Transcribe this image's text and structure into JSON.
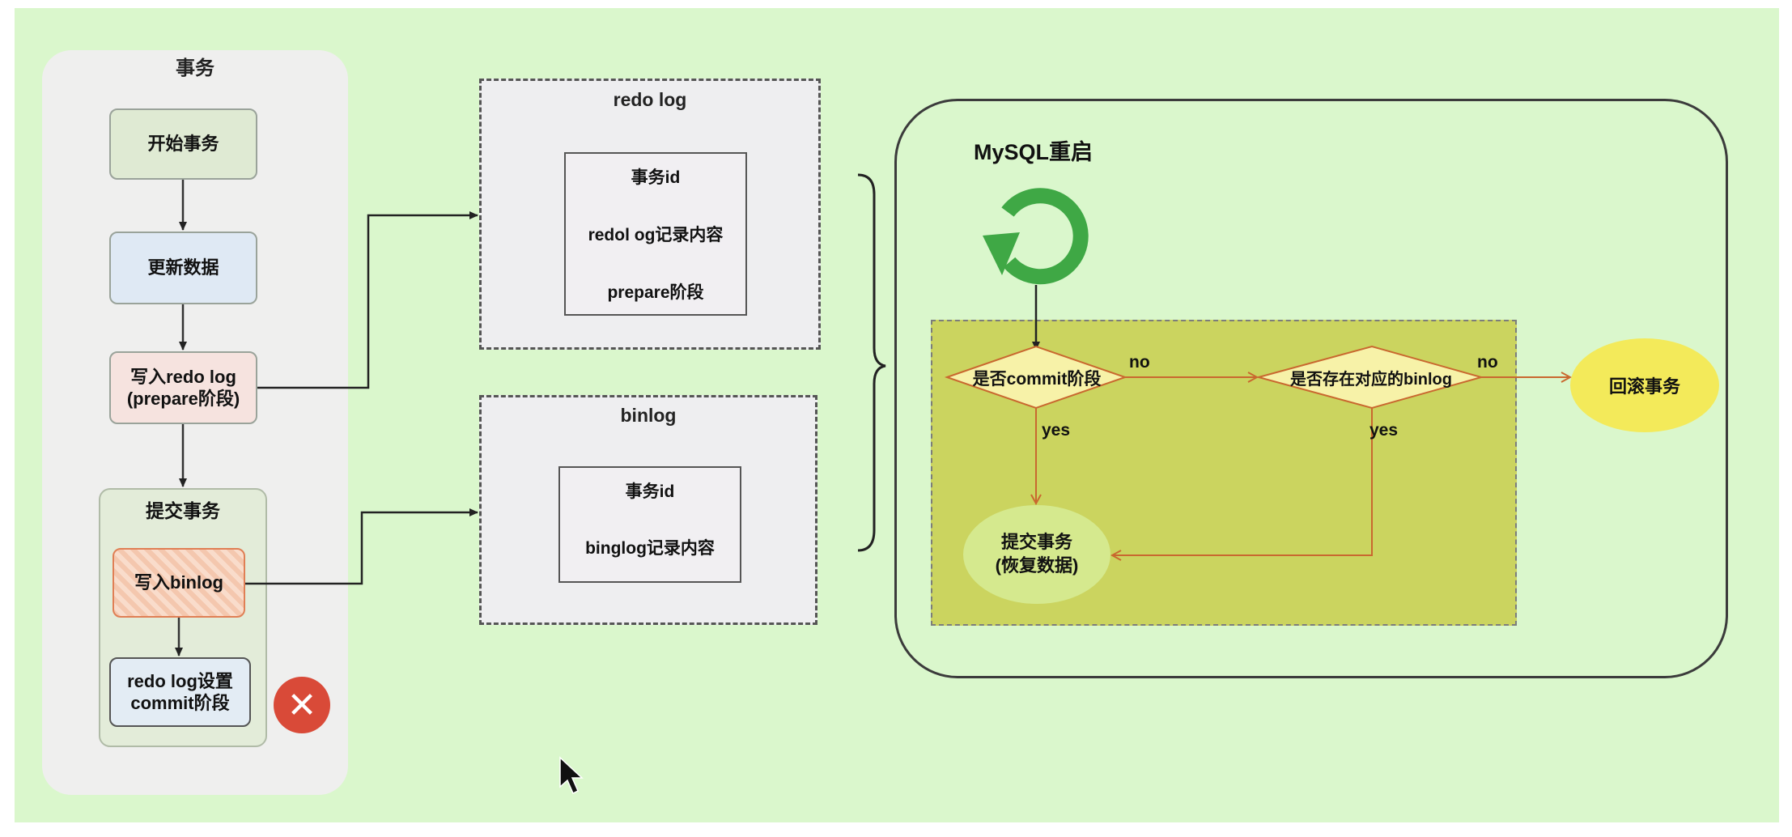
{
  "transaction": {
    "title": "事务",
    "start": "开始事务",
    "update": "更新数据",
    "write_redo_line1": "写入redo log",
    "write_redo_line2": "(prepare阶段)",
    "commit_title": "提交事务",
    "write_binlog": "写入binlog",
    "redo_commit_line1": "redo log设置",
    "redo_commit_line2": "commit阶段",
    "error_icon": "✕"
  },
  "redo_log": {
    "title": "redo log",
    "rows": [
      "事务id",
      "redol og记录内容",
      "prepare阶段"
    ]
  },
  "binlog": {
    "title": "binlog",
    "rows": [
      "事务id",
      "binglog记录内容"
    ]
  },
  "restart": {
    "title": "MySQL重启",
    "q1": "是否commit阶段",
    "q2": "是否存在对应的binlog",
    "no1": "no",
    "no2": "no",
    "yes1": "yes",
    "yes2": "yes",
    "commit_line1": "提交事务",
    "commit_line2": "(恢复数据)",
    "rollback": "回滚事务"
  },
  "colors": {
    "background": "#daf7cc",
    "restart_icon": "#3fa845",
    "error": "#d94a38",
    "orange_arrow": "#c9682f"
  },
  "icons": [
    "restart-icon",
    "error-x-icon",
    "mouse-cursor-icon"
  ]
}
